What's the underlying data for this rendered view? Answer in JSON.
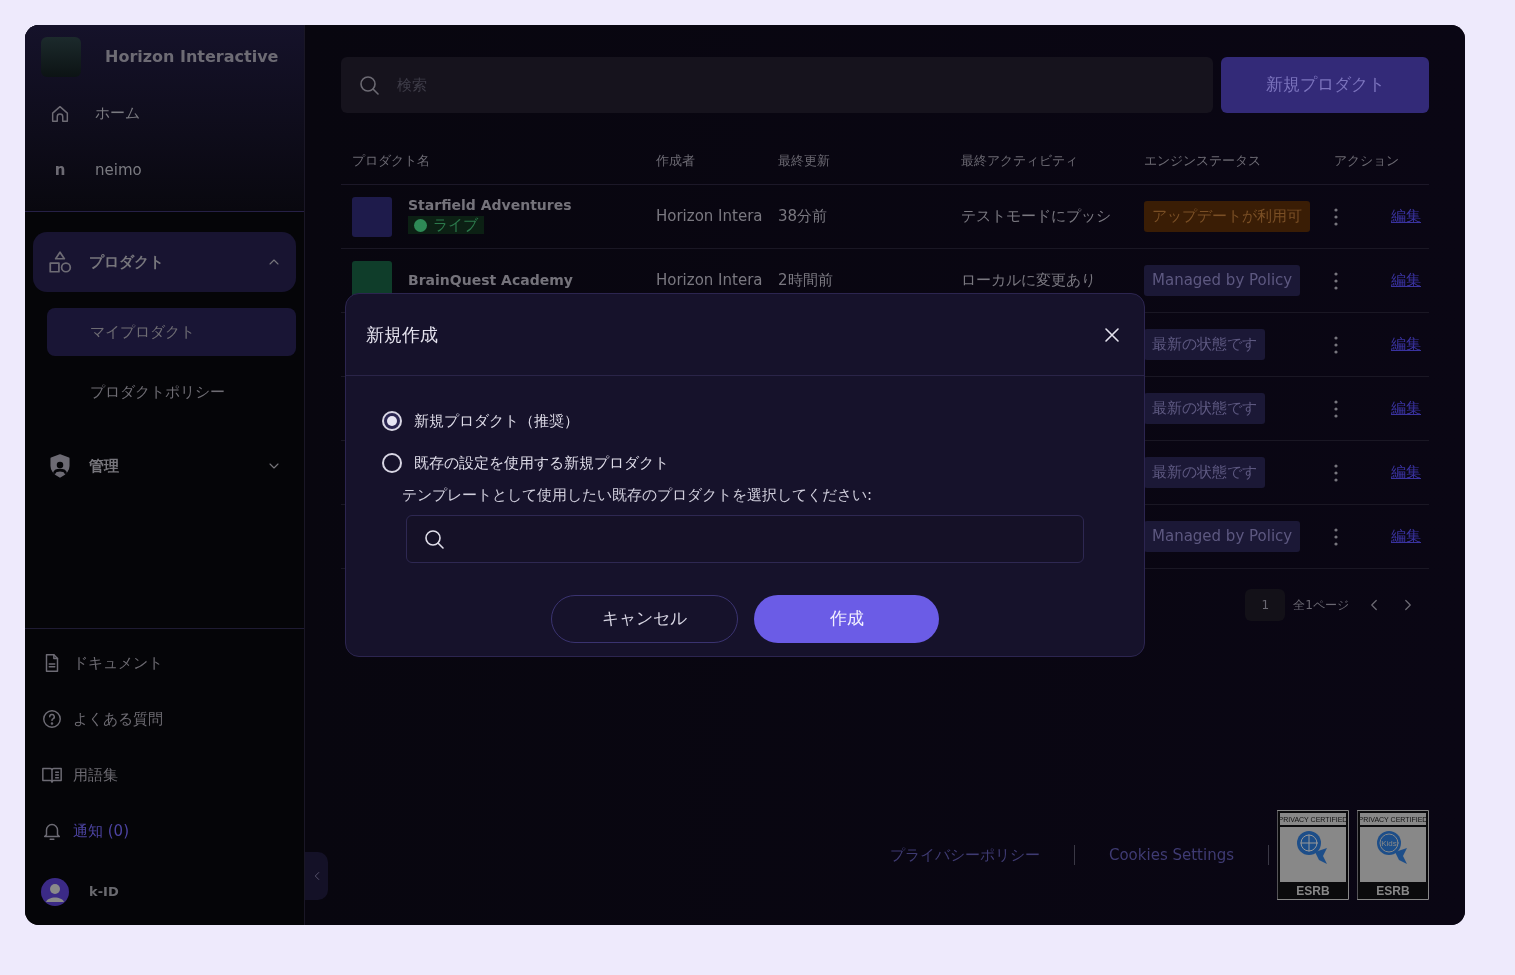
{
  "sidebar": {
    "brand": "Horizon Interactive",
    "top_items": [
      {
        "kind": "home",
        "label": "ホーム"
      },
      {
        "kind": "letter",
        "letter": "n",
        "label": "neimo"
      }
    ],
    "groups": [
      {
        "kind": "shapes",
        "label": "プロダクト",
        "expanded": true,
        "children": [
          {
            "label": "マイプロダクト",
            "selected": true
          },
          {
            "label": "プロダクトポリシー",
            "selected": false
          }
        ]
      },
      {
        "kind": "shield",
        "label": "管理",
        "expanded": false
      }
    ],
    "bottom_items": [
      {
        "kind": "doc",
        "label": "ドキュメント",
        "highlight": false
      },
      {
        "kind": "help",
        "label": "よくある質問",
        "highlight": false
      },
      {
        "kind": "book",
        "label": "用語集",
        "highlight": false
      },
      {
        "kind": "bell",
        "label": "通知 (0)",
        "highlight": true
      }
    ],
    "user": "k-ID"
  },
  "search": {
    "placeholder": "検索"
  },
  "new_button": "新規プロダクト",
  "table": {
    "columns": [
      "プロダクト名",
      "作成者",
      "最終更新",
      "最終アクティビティ",
      "エンジンステータス",
      "アクション"
    ],
    "rows": [
      {
        "name": "Starfield Adventures",
        "live": "ライブ",
        "author": "Horizon Intera",
        "updated": "38分前",
        "activity": "テストモードにプッシ",
        "engine_status": "アップデートが利用可",
        "kind": "update",
        "action": "編集"
      },
      {
        "name": "BrainQuest Academy",
        "author": "Horizon Intera",
        "updated": "2時間前",
        "activity": "ローカルに変更あり",
        "engine_status": "Managed by Policy",
        "kind": "policy",
        "action": "編集"
      },
      {
        "engine_status": "最新の状態です",
        "kind": "latest",
        "action": "編集"
      },
      {
        "engine_status": "最新の状態です",
        "kind": "latest",
        "action": "編集"
      },
      {
        "engine_status": "最新の状態です",
        "kind": "latest",
        "action": "編集"
      },
      {
        "engine_status": "Managed by Policy",
        "kind": "policy",
        "action": "編集"
      }
    ]
  },
  "pagination": {
    "page": "1",
    "total": "全1ページ"
  },
  "footer": {
    "links": [
      "プライバシーポリシー",
      "Cookies Settings"
    ],
    "badges": [
      {
        "kind": "globe",
        "top": "PRIVACY CERTIFIED",
        "bottom": "ESRB"
      },
      {
        "kind": "kids",
        "top": "PRIVACY CERTIFIED",
        "inner": "Kids",
        "bottom": "ESRB"
      }
    ]
  },
  "dialog": {
    "title": "新規作成",
    "options": [
      {
        "label": "新規プロダクト（推奨）",
        "selected": true
      },
      {
        "label": "既存の設定を使用する新規プロダクト",
        "selected": false
      }
    ],
    "hint": "テンプレートとして使用したい既存のプロダクトを選択してください:",
    "buttons": [
      "キャンセル",
      "作成"
    ]
  }
}
